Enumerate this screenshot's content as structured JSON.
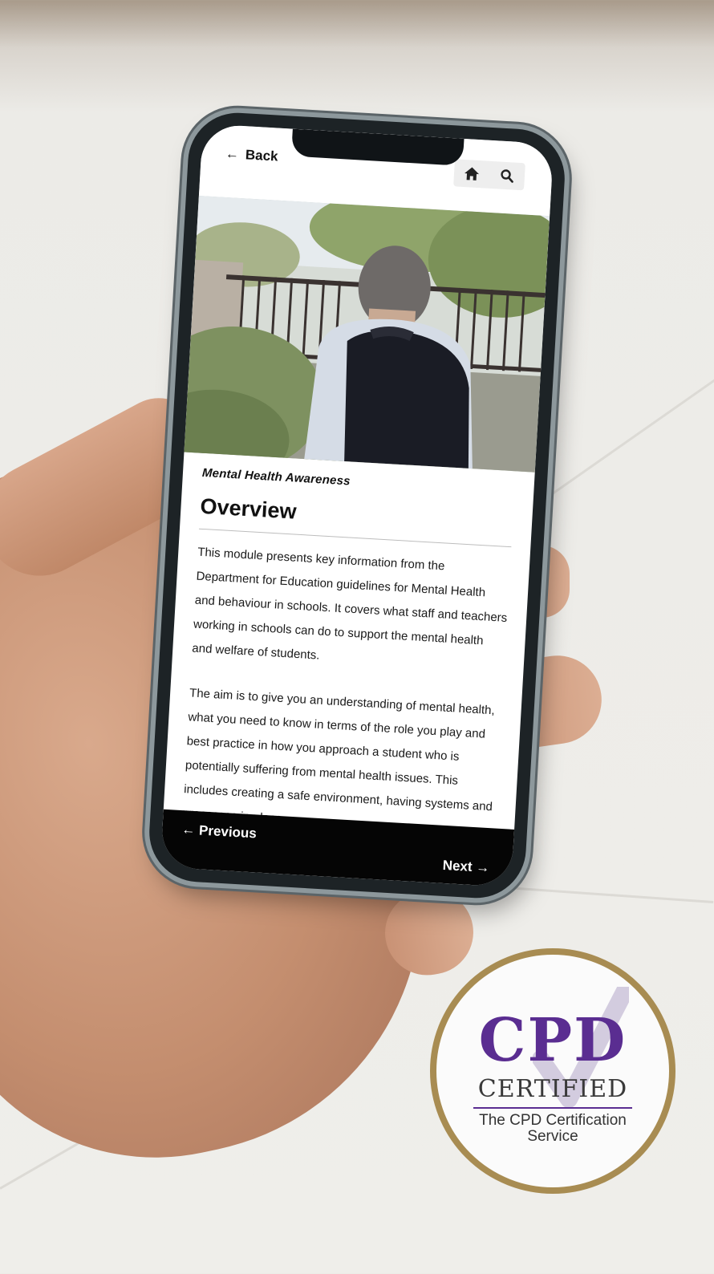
{
  "app": {
    "back_label": "Back",
    "home_icon": "home-icon",
    "search_icon": "search-icon"
  },
  "lesson": {
    "course_title": "Mental Health Awareness",
    "section_title": "Overview",
    "paragraphs": [
      "This module presents key information from the Department for Education guidelines for Mental Health and behaviour in schools. It covers what staff and teachers working in schools can do to support the mental health and welfare of students.",
      "The aim is to give you an understanding of mental health, what you need to know in terms of the role you play and best practice in how you approach a student who is potentially suffering from mental health issues. This includes creating a safe environment, having systems and processes in place"
    ]
  },
  "navigation": {
    "previous_label": "Previous",
    "next_label": "Next"
  },
  "badge": {
    "line1": "CPD",
    "line2": "CERTIFIED",
    "line3": "The CPD Certification",
    "line4": "Service"
  },
  "colors": {
    "badge_purple": "#5a2d91",
    "badge_ring": "#a88c52",
    "nav_background": "#050505"
  }
}
